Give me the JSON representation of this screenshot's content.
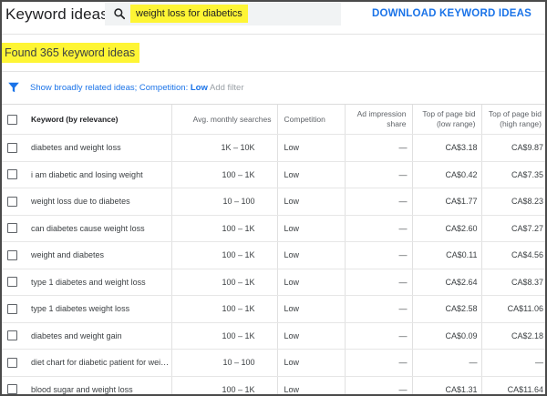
{
  "header": {
    "title": "Keyword ideas",
    "search_value": "weight loss for diabetics",
    "download_label": "DOWNLOAD KEYWORD IDEAS"
  },
  "found_count": "Found 365 keyword ideas",
  "filter": {
    "prefix": "Show broadly related ideas; Competition: ",
    "value": "Low",
    "add_filter": "Add filter"
  },
  "table": {
    "headers": {
      "keyword": "Keyword (by relevance)",
      "volume": "Avg. monthly searches",
      "competition": "Competition",
      "impression": "Ad impression share",
      "low_bid": "Top of page bid (low range)",
      "high_bid": "Top of page bid (high range)"
    },
    "rows": [
      {
        "keyword": "diabetes and weight loss",
        "volume": "1K – 10K",
        "competition": "Low",
        "impression": "—",
        "low_bid": "CA$3.18",
        "high_bid": "CA$9.87"
      },
      {
        "keyword": "i am diabetic and losing weight",
        "volume": "100 – 1K",
        "competition": "Low",
        "impression": "—",
        "low_bid": "CA$0.42",
        "high_bid": "CA$7.35"
      },
      {
        "keyword": "weight loss due to diabetes",
        "volume": "10 – 100",
        "competition": "Low",
        "impression": "—",
        "low_bid": "CA$1.77",
        "high_bid": "CA$8.23"
      },
      {
        "keyword": "can diabetes cause weight loss",
        "volume": "100 – 1K",
        "competition": "Low",
        "impression": "—",
        "low_bid": "CA$2.60",
        "high_bid": "CA$7.27"
      },
      {
        "keyword": "weight and diabetes",
        "volume": "100 – 1K",
        "competition": "Low",
        "impression": "—",
        "low_bid": "CA$0.11",
        "high_bid": "CA$4.56"
      },
      {
        "keyword": "type 1 diabetes and weight loss",
        "volume": "100 – 1K",
        "competition": "Low",
        "impression": "—",
        "low_bid": "CA$2.64",
        "high_bid": "CA$8.37"
      },
      {
        "keyword": "type 1 diabetes weight loss",
        "volume": "100 – 1K",
        "competition": "Low",
        "impression": "—",
        "low_bid": "CA$2.58",
        "high_bid": "CA$11.06"
      },
      {
        "keyword": "diabetes and weight gain",
        "volume": "100 – 1K",
        "competition": "Low",
        "impression": "—",
        "low_bid": "CA$0.09",
        "high_bid": "CA$2.18"
      },
      {
        "keyword": "diet chart for diabetic patient for wei…",
        "volume": "10 – 100",
        "competition": "Low",
        "impression": "—",
        "low_bid": "—",
        "high_bid": "—"
      },
      {
        "keyword": "blood sugar and weight loss",
        "volume": "100 – 1K",
        "competition": "Low",
        "impression": "—",
        "low_bid": "CA$1.31",
        "high_bid": "CA$11.64"
      }
    ]
  },
  "colors": {
    "accent": "#1a73e8",
    "highlight": "#fef534"
  }
}
